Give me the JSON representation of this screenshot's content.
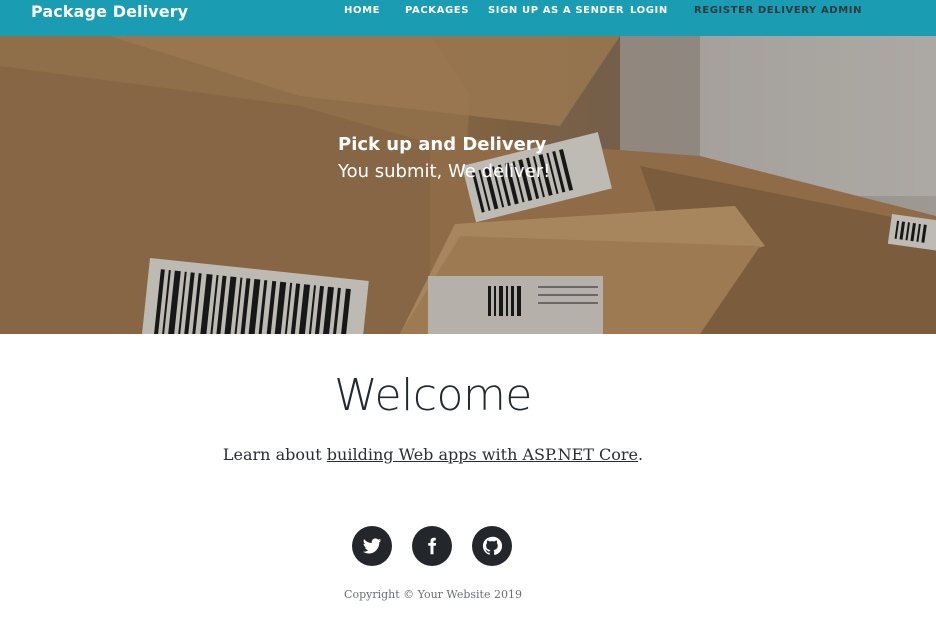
{
  "navbar": {
    "brand": "Package Delivery",
    "links": [
      "HOME",
      "PACKAGES",
      "SIGN UP AS A SENDER",
      "LOGIN",
      "REGISTER DELIVERY ADMIN"
    ]
  },
  "hero": {
    "title": "Pick up and Delivery",
    "subtitle": "You submit, We deliver!"
  },
  "main": {
    "heading": "Welcome",
    "learn_prefix": "Learn about ",
    "learn_link": "building Web apps with ASP.NET Core",
    "learn_suffix": "."
  },
  "social": {
    "icons": [
      "twitter-icon",
      "facebook-icon",
      "github-icon"
    ]
  },
  "footer": {
    "copyright": "Copyright © Your Website 2019"
  },
  "colors": {
    "navbar": "#1a9db3",
    "social_button": "#23272b"
  }
}
